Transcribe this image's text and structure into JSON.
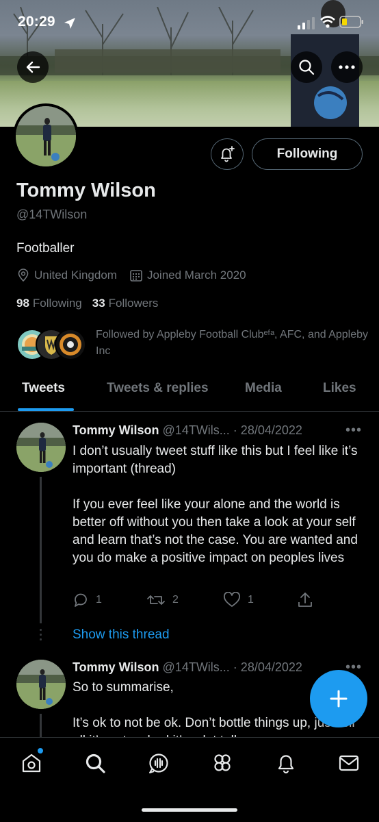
{
  "status_bar": {
    "time": "20:29"
  },
  "profile": {
    "display_name": "Tommy Wilson",
    "handle": "@14TWilson",
    "bio": "Footballer",
    "location": "United Kingdom",
    "joined": "Joined March 2020",
    "following_count": "98",
    "following_label": "Following",
    "followers_count": "33",
    "followers_label": "Followers",
    "followed_by": "Followed by Appleby Football Clubᵉᶠᵃ, AFC, and Appleby Inc",
    "follow_button_label": "Following"
  },
  "tabs": [
    {
      "label": "Tweets",
      "active": true
    },
    {
      "label": "Tweets & replies",
      "active": false
    },
    {
      "label": "Media",
      "active": false
    },
    {
      "label": "Likes",
      "active": false
    }
  ],
  "tweets": [
    {
      "name": "Tommy Wilson",
      "handle_date": "@14TWils... · 28/04/2022",
      "text_1": "I don’t usually tweet stuff like this but I feel like it’s important (thread)",
      "text_2": "If you ever feel like your alone and the world is better off without you then take a look at your self and learn that’s not the case. You are wanted and you do make a positive impact on peoples lives",
      "replies": "1",
      "retweets": "2",
      "likes": "1",
      "show_thread": "Show this thread"
    },
    {
      "name": "Tommy Wilson",
      "handle_date": "@14TWils... · 28/04/2022",
      "text_1": "So to summarise,",
      "text_2": "It’s ok to not be ok. Don’t bottle things up, just tell all it’s not as bad it’s a lot tell"
    }
  ],
  "icons": {
    "back": "back-arrow-icon",
    "search": "search-icon",
    "more": "more-icon",
    "notification": "bell-plus-icon",
    "location": "location-pin-icon",
    "calendar": "calendar-icon",
    "reply": "reply-icon",
    "retweet": "retweet-icon",
    "like": "heart-icon",
    "share": "share-icon",
    "compose": "plus-icon",
    "nav": [
      "home-icon",
      "search-icon",
      "spaces-icon",
      "communities-icon",
      "notifications-icon",
      "messages-icon"
    ]
  },
  "colors": {
    "accent": "#1d9bf0",
    "background": "#000000",
    "secondary_text": "#71767b",
    "primary_text": "#e7e9ea"
  }
}
